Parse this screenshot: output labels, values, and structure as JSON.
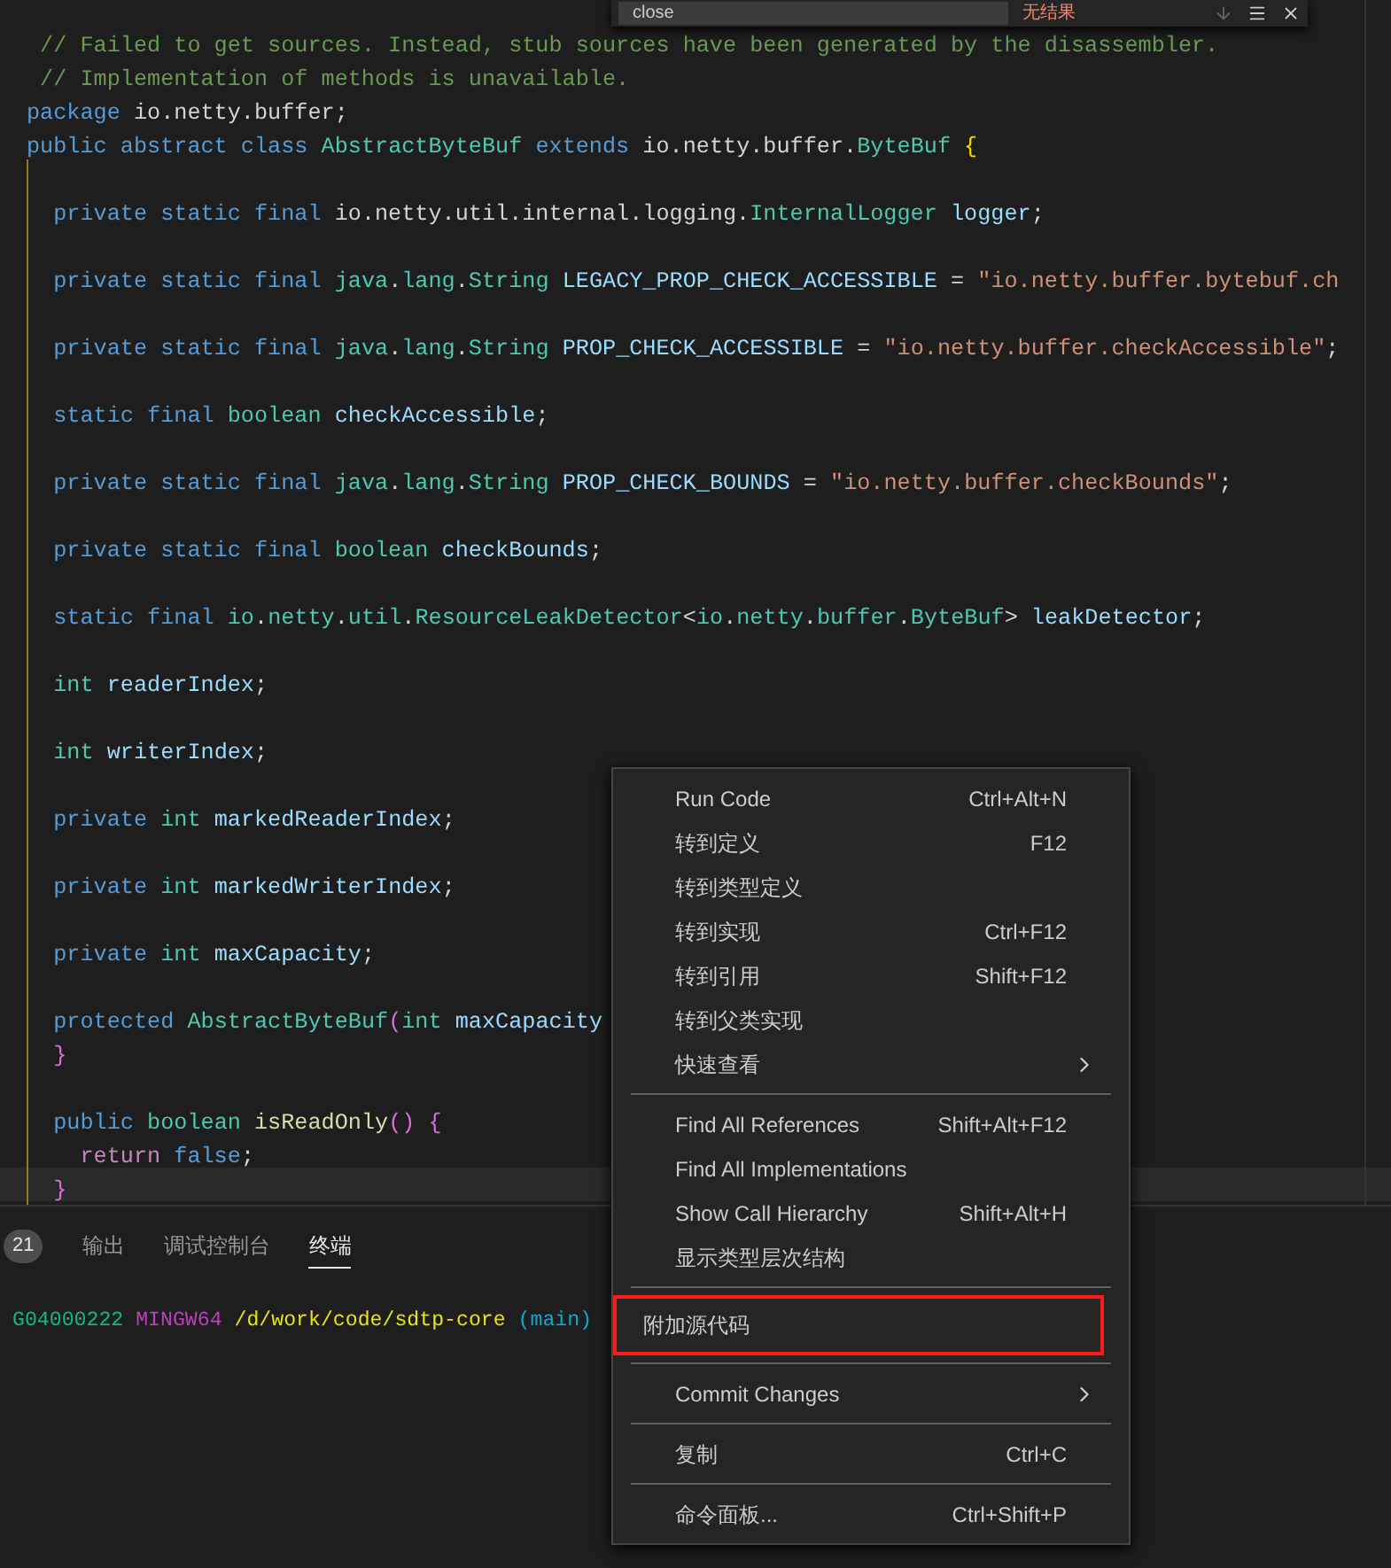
{
  "find_widget": {
    "value": "close",
    "result": "无结果"
  },
  "code": {
    "blocks": [
      [
        {
          "current": false,
          "tokens": [
            {
              "kind": "comment",
              "text": " // Failed to get sources. Instead, stub sources have been generated by the disassembler."
            }
          ]
        },
        {
          "current": false,
          "tokens": [
            {
              "kind": "comment",
              "text": " // Implementation of methods is unavailable."
            }
          ]
        },
        {
          "current": false,
          "tokens": [
            {
              "kind": "keyword",
              "text": "package"
            },
            {
              "kind": "plain",
              "text": " io.netty.buffer;"
            }
          ]
        },
        {
          "current": false,
          "tokens": [
            {
              "kind": "keyword",
              "text": "public abstract class"
            },
            {
              "kind": "type",
              "text": " AbstractByteBuf"
            },
            {
              "kind": "keyword",
              "text": " extends"
            },
            {
              "kind": "plain",
              "text": " io.netty.buffer."
            },
            {
              "kind": "type",
              "text": "ByteBuf"
            },
            {
              "kind": "brace",
              "text": " {"
            }
          ]
        }
      ],
      [
        {
          "current": false,
          "tokens": [
            {
              "kind": "keyword",
              "text": "  private static final"
            },
            {
              "kind": "plain",
              "text": " io.netty.util.internal.logging."
            },
            {
              "kind": "type",
              "text": "InternalLogger"
            },
            {
              "kind": "name",
              "text": " logger"
            },
            {
              "kind": "plain",
              "text": ";"
            }
          ]
        }
      ],
      [
        {
          "current": false,
          "tokens": [
            {
              "kind": "keyword",
              "text": "  private static final"
            },
            {
              "kind": "type",
              "text": " java"
            },
            {
              "kind": "plain",
              "text": "."
            },
            {
              "kind": "type",
              "text": "lang"
            },
            {
              "kind": "plain",
              "text": "."
            },
            {
              "kind": "type",
              "text": "String"
            },
            {
              "kind": "name",
              "text": " LEGACY_PROP_CHECK_ACCESSIBLE"
            },
            {
              "kind": "plain",
              "text": " ="
            },
            {
              "kind": "string",
              "text": " \"io.netty.buffer.bytebuf.ch"
            }
          ]
        }
      ],
      [
        {
          "current": false,
          "tokens": [
            {
              "kind": "keyword",
              "text": "  private static final"
            },
            {
              "kind": "type",
              "text": " java"
            },
            {
              "kind": "plain",
              "text": "."
            },
            {
              "kind": "type",
              "text": "lang"
            },
            {
              "kind": "plain",
              "text": "."
            },
            {
              "kind": "type",
              "text": "String"
            },
            {
              "kind": "name",
              "text": " PROP_CHECK_ACCESSIBLE"
            },
            {
              "kind": "plain",
              "text": " ="
            },
            {
              "kind": "string",
              "text": " \"io.netty.buffer.checkAccessible\""
            },
            {
              "kind": "plain",
              "text": ";"
            }
          ]
        }
      ],
      [
        {
          "current": false,
          "tokens": [
            {
              "kind": "keyword",
              "text": "  static final"
            },
            {
              "kind": "type",
              "text": " boolean"
            },
            {
              "kind": "name",
              "text": " checkAccessible"
            },
            {
              "kind": "plain",
              "text": ";"
            }
          ]
        }
      ],
      [
        {
          "current": false,
          "tokens": [
            {
              "kind": "keyword",
              "text": "  private static final"
            },
            {
              "kind": "type",
              "text": " java"
            },
            {
              "kind": "plain",
              "text": "."
            },
            {
              "kind": "type",
              "text": "lang"
            },
            {
              "kind": "plain",
              "text": "."
            },
            {
              "kind": "type",
              "text": "String"
            },
            {
              "kind": "name",
              "text": " PROP_CHECK_BOUNDS"
            },
            {
              "kind": "plain",
              "text": " ="
            },
            {
              "kind": "string",
              "text": " \"io.netty.buffer.checkBounds\""
            },
            {
              "kind": "plain",
              "text": ";"
            }
          ]
        }
      ],
      [
        {
          "current": false,
          "tokens": [
            {
              "kind": "keyword",
              "text": "  private static final"
            },
            {
              "kind": "type",
              "text": " boolean"
            },
            {
              "kind": "name",
              "text": " checkBounds"
            },
            {
              "kind": "plain",
              "text": ";"
            }
          ]
        }
      ],
      [
        {
          "current": false,
          "tokens": [
            {
              "kind": "keyword",
              "text": "  static final"
            },
            {
              "kind": "type",
              "text": " io"
            },
            {
              "kind": "plain",
              "text": "."
            },
            {
              "kind": "type",
              "text": "netty"
            },
            {
              "kind": "plain",
              "text": "."
            },
            {
              "kind": "type",
              "text": "util"
            },
            {
              "kind": "plain",
              "text": "."
            },
            {
              "kind": "type",
              "text": "ResourceLeakDetector"
            },
            {
              "kind": "plain",
              "text": "<"
            },
            {
              "kind": "type",
              "text": "io"
            },
            {
              "kind": "plain",
              "text": "."
            },
            {
              "kind": "type",
              "text": "netty"
            },
            {
              "kind": "plain",
              "text": "."
            },
            {
              "kind": "type",
              "text": "buffer"
            },
            {
              "kind": "plain",
              "text": "."
            },
            {
              "kind": "type",
              "text": "ByteBuf"
            },
            {
              "kind": "plain",
              "text": ">"
            },
            {
              "kind": "name",
              "text": " leakDetector"
            },
            {
              "kind": "plain",
              "text": ";"
            }
          ]
        }
      ],
      [
        {
          "current": false,
          "tokens": [
            {
              "kind": "type",
              "text": "  int"
            },
            {
              "kind": "name",
              "text": " readerIndex"
            },
            {
              "kind": "plain",
              "text": ";"
            }
          ]
        }
      ],
      [
        {
          "current": false,
          "tokens": [
            {
              "kind": "type",
              "text": "  int"
            },
            {
              "kind": "name",
              "text": " writerIndex"
            },
            {
              "kind": "plain",
              "text": ";"
            }
          ]
        }
      ],
      [
        {
          "current": false,
          "tokens": [
            {
              "kind": "keyword",
              "text": "  private"
            },
            {
              "kind": "type",
              "text": " int"
            },
            {
              "kind": "name",
              "text": " markedReaderIndex"
            },
            {
              "kind": "plain",
              "text": ";"
            }
          ]
        }
      ],
      [
        {
          "current": false,
          "tokens": [
            {
              "kind": "keyword",
              "text": "  private"
            },
            {
              "kind": "type",
              "text": " int"
            },
            {
              "kind": "name",
              "text": " markedWriterIndex"
            },
            {
              "kind": "plain",
              "text": ";"
            }
          ]
        }
      ],
      [
        {
          "current": false,
          "tokens": [
            {
              "kind": "keyword",
              "text": "  private"
            },
            {
              "kind": "type",
              "text": " int"
            },
            {
              "kind": "name",
              "text": " maxCapacity"
            },
            {
              "kind": "plain",
              "text": ";"
            }
          ]
        }
      ],
      [
        {
          "current": false,
          "tokens": [
            {
              "kind": "keyword",
              "text": "  protected"
            },
            {
              "kind": "type",
              "text": " AbstractByteBuf"
            },
            {
              "kind": "brace2",
              "text": "("
            },
            {
              "kind": "type",
              "text": "int"
            },
            {
              "kind": "name",
              "text": " maxCapacity"
            }
          ]
        },
        {
          "current": false,
          "tokens": [
            {
              "kind": "brace2",
              "text": "  }"
            }
          ]
        }
      ],
      [
        {
          "current": false,
          "tokens": [
            {
              "kind": "keyword",
              "text": "  public"
            },
            {
              "kind": "type",
              "text": " boolean"
            },
            {
              "kind": "func",
              "text": " isReadOnly"
            },
            {
              "kind": "brace2",
              "text": "()"
            },
            {
              "kind": "brace2",
              "text": " {"
            }
          ]
        },
        {
          "current": false,
          "tokens": [
            {
              "kind": "control",
              "text": "    return"
            },
            {
              "kind": "keyword",
              "text": " false"
            },
            {
              "kind": "plain",
              "text": ";"
            }
          ]
        },
        {
          "current": true,
          "tokens": [
            {
              "kind": "brace2",
              "text": "  }"
            }
          ]
        }
      ]
    ]
  },
  "panel": {
    "tabs": [
      {
        "badge": "21",
        "selected": false
      },
      {
        "label": "输出",
        "selected": false
      },
      {
        "label": "调试控制台",
        "selected": false
      },
      {
        "label": "终端",
        "selected": true
      }
    ],
    "terminal": [
      {
        "kind": "user",
        "text": "G04000222"
      },
      {
        "kind": "system",
        "text": "MINGW64"
      },
      {
        "kind": "path",
        "text": "/d/work/code/sdtp-core"
      },
      {
        "kind": "branch",
        "text": "(main)"
      }
    ]
  },
  "context_menu": {
    "groups": [
      [
        {
          "label": "Run Code",
          "shortcut": "Ctrl+Alt+N",
          "submenu": false,
          "highlighted": false
        },
        {
          "label": "转到定义",
          "shortcut": "F12",
          "submenu": false,
          "highlighted": false
        },
        {
          "label": "转到类型定义",
          "submenu": false,
          "highlighted": false
        },
        {
          "label": "转到实现",
          "shortcut": "Ctrl+F12",
          "submenu": false,
          "highlighted": false
        },
        {
          "label": "转到引用",
          "shortcut": "Shift+F12",
          "submenu": false,
          "highlighted": false
        },
        {
          "label": "转到父类实现",
          "submenu": false,
          "highlighted": false
        },
        {
          "label": "快速查看",
          "submenu": true,
          "highlighted": false
        }
      ],
      [
        {
          "label": "Find All References",
          "shortcut": "Shift+Alt+F12",
          "submenu": false,
          "highlighted": false
        },
        {
          "label": "Find All Implementations",
          "submenu": false,
          "highlighted": false
        },
        {
          "label": "Show Call Hierarchy",
          "shortcut": "Shift+Alt+H",
          "submenu": false,
          "highlighted": false
        },
        {
          "label": "显示类型层次结构",
          "submenu": false,
          "highlighted": false
        }
      ],
      [
        {
          "label": "附加源代码",
          "submenu": false,
          "highlighted": true
        }
      ],
      [
        {
          "label": "Commit Changes",
          "submenu": true,
          "highlighted": false
        }
      ],
      [
        {
          "label": "复制",
          "shortcut": "Ctrl+C",
          "submenu": false,
          "highlighted": false
        }
      ],
      [
        {
          "label": "命令面板...",
          "shortcut": "Ctrl+Shift+P",
          "submenu": false,
          "highlighted": false
        }
      ]
    ]
  }
}
